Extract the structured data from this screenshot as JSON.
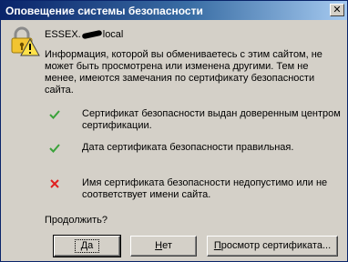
{
  "window": {
    "title": "Оповещение системы безопасности",
    "close_glyph": "✕"
  },
  "host": {
    "prefix": "ESSEX.",
    "suffix": "local"
  },
  "message": "Информация, которой вы обмениваетесь с этим сайтом, не может быть просмотрена или изменена другими. Тем не менее, имеются замечания по сертификату безопасности сайта.",
  "checks": [
    {
      "status": "ok",
      "icon": "check-icon",
      "color": "#3aa23a",
      "text": "Сертификат безопасности выдан доверенным центром сертификации."
    },
    {
      "status": "ok",
      "icon": "check-icon",
      "color": "#3aa23a",
      "text": "Дата сертификата безопасности правильная."
    },
    {
      "status": "error",
      "icon": "cross-icon",
      "color": "#e02020",
      "text": "Имя сертификата безопасности недопустимо или не соответствует имени сайта."
    }
  ],
  "prompt": "Продолжить?",
  "buttons": {
    "yes": {
      "accel": "Д",
      "rest": "а"
    },
    "no": {
      "accel": "Н",
      "rest": "ет"
    },
    "view": {
      "pre": "",
      "accel": "П",
      "rest": "росмотр сертификата..."
    }
  }
}
